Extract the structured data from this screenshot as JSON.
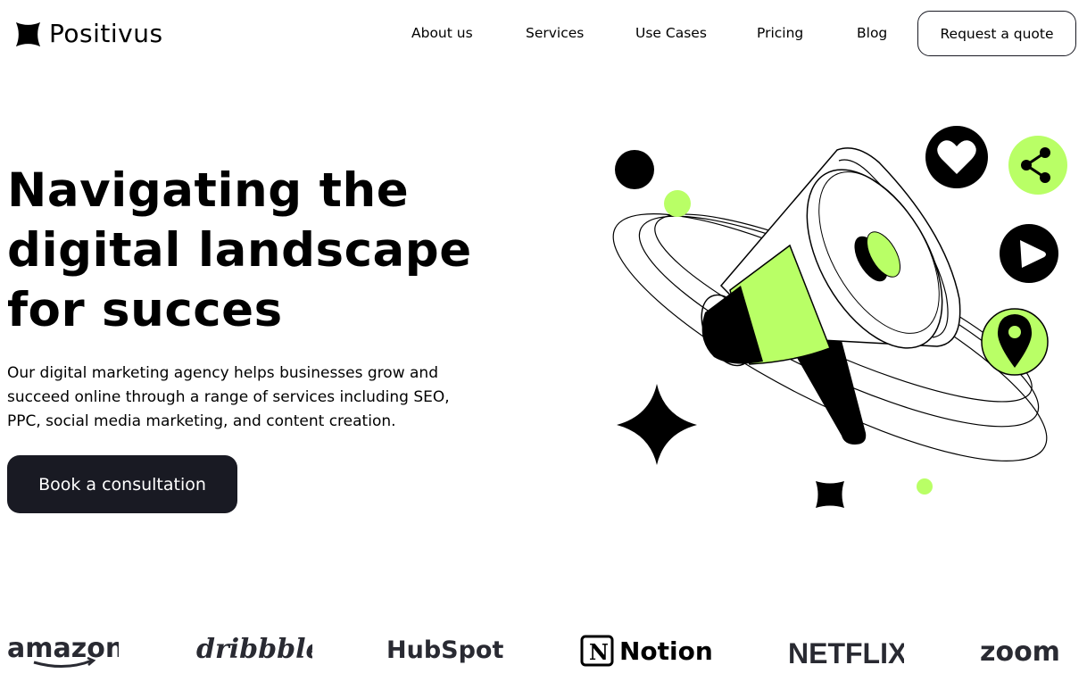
{
  "brand": {
    "name": "Positivus"
  },
  "nav": {
    "items": [
      {
        "label": "About us"
      },
      {
        "label": "Services"
      },
      {
        "label": "Use Cases"
      },
      {
        "label": "Pricing"
      },
      {
        "label": "Blog"
      }
    ],
    "cta_label": "Request a quote"
  },
  "hero": {
    "title_lines": [
      "Navigating the",
      "digital landscape",
      "for succes"
    ],
    "description_lines": [
      "Our digital marketing agency helps businesses grow and",
      "succeed online through a range of services including SEO,",
      "PPC, social media marketing, and content creation."
    ],
    "button_label": "Book a consultation"
  },
  "illustration": {
    "icons": [
      "heart-icon",
      "share-icon",
      "play-icon",
      "location-pin-icon",
      "megaphone-icon",
      "sparkle-icon"
    ],
    "colors": {
      "accent": "#b9ff66",
      "dark": "#191a23"
    }
  },
  "client_logos": [
    {
      "name": "amazon"
    },
    {
      "name": "dribbble"
    },
    {
      "name": "HubSpot"
    },
    {
      "name": "Notion"
    },
    {
      "name": "NETFLIX"
    },
    {
      "name": "zoom"
    }
  ]
}
